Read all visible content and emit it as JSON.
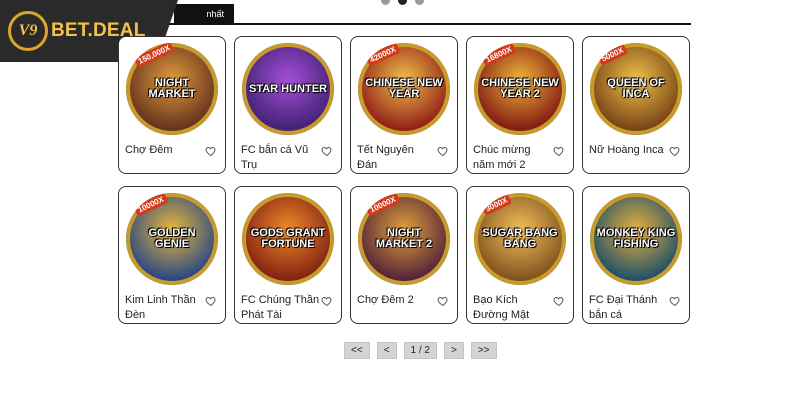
{
  "brand": {
    "logo_mark": "V9",
    "name": "BET.DEAL"
  },
  "tabs": {
    "active_label": "nhất"
  },
  "carousel": {
    "dots": 3,
    "active_index": 1
  },
  "games": [
    {
      "name": "Chợ Đêm",
      "art": "NIGHT MARKET",
      "badge": "150,000X",
      "colors": [
        "#5b2a1c",
        "#e09a3a"
      ]
    },
    {
      "name": "FC bắn cá Vũ Trụ",
      "art": "STAR HUNTER",
      "badge": "",
      "colors": [
        "#3b1f6e",
        "#a34fd6"
      ]
    },
    {
      "name": "Tết Nguyên Đán",
      "art": "CHINESE NEW YEAR",
      "badge": "42000X",
      "colors": [
        "#8a1313",
        "#f2c04a"
      ]
    },
    {
      "name": "Chúc mừng năm mới 2",
      "art": "CHINESE NEW YEAR 2",
      "badge": "16800X",
      "colors": [
        "#7a0f0f",
        "#f0b43a"
      ]
    },
    {
      "name": "Nữ Hoàng Inca",
      "art": "QUEEN OF INCA",
      "badge": "5000X",
      "colors": [
        "#6e3a12",
        "#f0c24a"
      ]
    },
    {
      "name": "Kim Linh Thần Đèn",
      "art": "GOLDEN GENIE",
      "badge": "10000X",
      "colors": [
        "#1b3f8a",
        "#e8b83a"
      ]
    },
    {
      "name": "FC Chúng Thần Phát Tài",
      "art": "GODS GRANT FORTUNE",
      "badge": "",
      "colors": [
        "#7a1a10",
        "#f28a2a"
      ]
    },
    {
      "name": "Chợ Đêm 2",
      "art": "NIGHT MARKET 2",
      "badge": "10000X",
      "colors": [
        "#4a1a3a",
        "#e0a03a"
      ]
    },
    {
      "name": "Bạo Kích Đường Mật",
      "art": "SUGAR BANG BANG",
      "badge": "3000X",
      "colors": [
        "#7a4a1a",
        "#f0c05a"
      ]
    },
    {
      "name": "FC Đại Thánh bắn cá",
      "art": "MONKEY KING FISHING",
      "badge": "",
      "colors": [
        "#0f4a6a",
        "#e8b040"
      ]
    }
  ],
  "pagination": {
    "first": "<<",
    "prev": "<",
    "page": "1 / 2",
    "next": ">",
    "last": ">>"
  }
}
